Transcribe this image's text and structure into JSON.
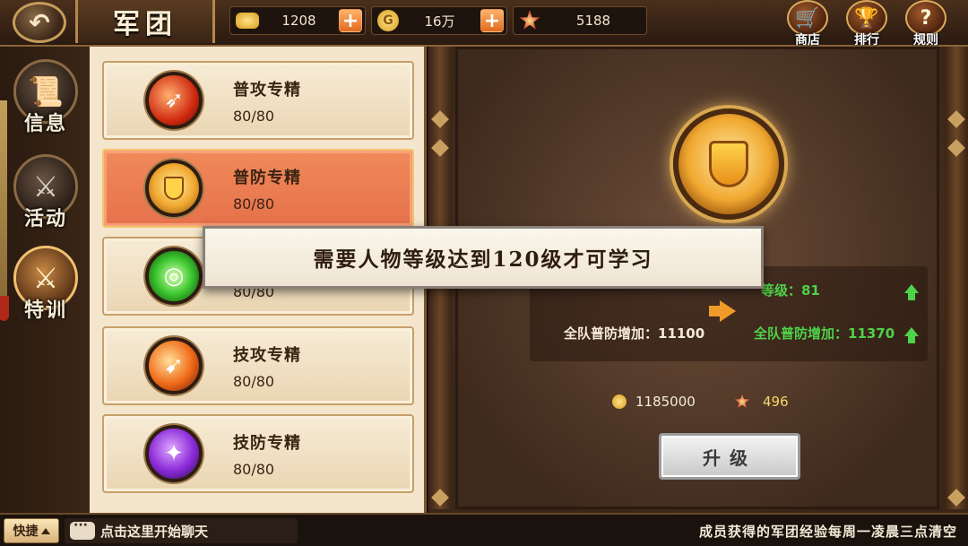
{
  "header": {
    "title": "军团",
    "resources": [
      {
        "icon": "ingot-icon",
        "value": "1208"
      },
      {
        "icon": "gold-coin-icon",
        "value": "16万"
      },
      {
        "icon": "legion-medal-icon",
        "value": "5188"
      }
    ],
    "buttons": [
      {
        "icon": "shop-cart-icon",
        "label": "商店"
      },
      {
        "icon": "trophy-icon",
        "label": "排行"
      },
      {
        "icon": "question-icon",
        "label": "规则"
      }
    ]
  },
  "sidebar": {
    "items": [
      {
        "label": "信息",
        "icon": "scroll-icon",
        "active": false
      },
      {
        "label": "活动",
        "icon": "battle-icon",
        "active": false
      },
      {
        "label": "特训",
        "icon": "crossed-swords-icon",
        "active": true
      }
    ]
  },
  "skills": [
    {
      "name": "普攻专精",
      "progress": "80/80",
      "icon": "normal-attack-icon",
      "active": false
    },
    {
      "name": "普防专精",
      "progress": "80/80",
      "icon": "normal-defense-icon",
      "active": true
    },
    {
      "name": "",
      "progress": "80/80",
      "icon": "green-vortex-icon",
      "active": false
    },
    {
      "name": "技攻专精",
      "progress": "80/80",
      "icon": "skill-attack-icon",
      "active": false
    },
    {
      "name": "技防专精",
      "progress": "80/80",
      "icon": "skill-defense-icon",
      "active": false
    }
  ],
  "detail": {
    "emblem_icon": "defense-shield-icon",
    "level_next": "等级：81",
    "team_def_current": "全队普防增加：11100",
    "team_def_next": "全队普防增加：11370",
    "cost_gold": "1185000",
    "cost_medal": "496",
    "upgrade_label": "升级"
  },
  "toast": {
    "message": "需要人物等级达到120级才可学习"
  },
  "footer": {
    "quick_label": "快捷",
    "chat_placeholder": "点击这里开始聊天",
    "notice": "成员获得的军团经验每周一凌晨三点清空"
  },
  "colors": {
    "accent_orange": "#e6714a",
    "stat_green": "#4ed24a",
    "cost_yellow": "#f5d86a",
    "panel_beige": "#f3e6cc"
  }
}
